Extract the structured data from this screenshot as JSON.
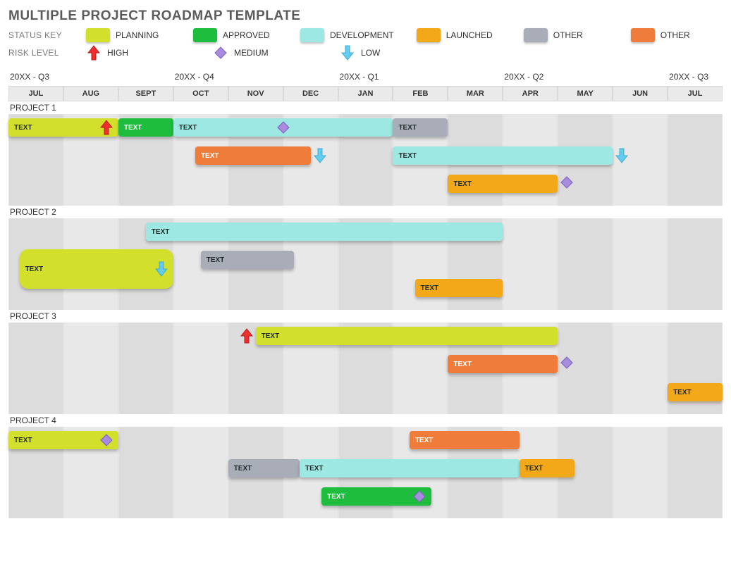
{
  "title": "MULTIPLE PROJECT ROADMAP TEMPLATE",
  "status_key_label": "STATUS KEY",
  "risk_level_label": "RISK LEVEL",
  "status_key": [
    {
      "name": "PLANNING",
      "color": "#d3e02b"
    },
    {
      "name": "APPROVED",
      "color": "#1ebd3d"
    },
    {
      "name": "DEVELOPMENT",
      "color": "#9ee8e3"
    },
    {
      "name": "LAUNCHED",
      "color": "#f2a818"
    },
    {
      "name": "OTHER",
      "color": "#a9adb8"
    },
    {
      "name": "OTHER",
      "color": "#f07c3a"
    }
  ],
  "risk_levels": [
    {
      "name": "HIGH",
      "icon": "arrow-up-red"
    },
    {
      "name": "MEDIUM",
      "icon": "diamond-purple"
    },
    {
      "name": "LOW",
      "icon": "arrow-down-cyan"
    }
  ],
  "quarters": [
    "20XX - Q3",
    "",
    "",
    "20XX - Q4",
    "",
    "",
    "20XX - Q1",
    "",
    "",
    "20XX - Q2",
    "",
    "",
    "20XX - Q3"
  ],
  "months": [
    "JUL",
    "AUG",
    "SEPT",
    "OCT",
    "NOV",
    "DEC",
    "JAN",
    "FEB",
    "MAR",
    "APR",
    "MAY",
    "JUN",
    "JUL"
  ],
  "projects": [
    "PROJECT 1",
    "PROJECT 2",
    "PROJECT 3",
    "PROJECT 4"
  ],
  "chart_data": {
    "type": "gantt",
    "x_units": "months",
    "x_index_zero": "JUL",
    "columns": 13,
    "sections": [
      {
        "name": "PROJECT 1",
        "rows": 3,
        "bars": [
          {
            "label": "TEXT",
            "status": "planning",
            "start": 0,
            "end": 2,
            "row": 0,
            "risk": "high"
          },
          {
            "label": "TEXT",
            "status": "approved",
            "start": 2,
            "end": 3,
            "row": 0
          },
          {
            "label": "TEXT",
            "status": "development",
            "start": 3,
            "end": 7,
            "row": 0,
            "risk": "medium",
            "risk_pos": "mid"
          },
          {
            "label": "TEXT",
            "status": "other1",
            "start": 7,
            "end": 8,
            "row": 0
          },
          {
            "label": "TEXT",
            "status": "other2",
            "start": 3.4,
            "end": 5.5,
            "row": 1,
            "risk": "low",
            "risk_pos": "outside-right"
          },
          {
            "label": "TEXT",
            "status": "development",
            "start": 7,
            "end": 11,
            "row": 1,
            "risk": "low",
            "risk_pos": "outside-right"
          },
          {
            "label": "TEXT",
            "status": "launched",
            "start": 8,
            "end": 10,
            "row": 2,
            "risk": "medium",
            "risk_pos": "outside-right"
          }
        ]
      },
      {
        "name": "PROJECT 2",
        "rows": 3,
        "bars": [
          {
            "label": "TEXT",
            "status": "development",
            "start": 2.5,
            "end": 9,
            "row": 0
          },
          {
            "label": "TEXT",
            "status": "planning",
            "start": 0.2,
            "end": 3,
            "row": 1,
            "big": true,
            "risk": "low"
          },
          {
            "label": "TEXT",
            "status": "other1",
            "start": 3.5,
            "end": 5.2,
            "row": 1
          },
          {
            "label": "TEXT",
            "status": "launched",
            "start": 7.4,
            "end": 9,
            "row": 2
          }
        ]
      },
      {
        "name": "PROJECT 3",
        "rows": 3,
        "bars": [
          {
            "label": "TEXT",
            "status": "planning",
            "start": 4.5,
            "end": 10,
            "row": 0,
            "risk": "high",
            "risk_pos": "outside-left"
          },
          {
            "label": "TEXT",
            "status": "other2",
            "start": 8,
            "end": 10,
            "row": 1,
            "risk": "medium",
            "risk_pos": "outside-right"
          },
          {
            "label": "TEXT",
            "status": "launched",
            "start": 12,
            "end": 13,
            "row": 2
          }
        ]
      },
      {
        "name": "PROJECT 4",
        "rows": 3,
        "bars": [
          {
            "label": "TEXT",
            "status": "planning",
            "start": 0,
            "end": 2,
            "row": 0,
            "risk": "medium"
          },
          {
            "label": "TEXT",
            "status": "other2",
            "start": 7.3,
            "end": 9.3,
            "row": 0
          },
          {
            "label": "TEXT",
            "status": "other1",
            "start": 4,
            "end": 5.3,
            "row": 1
          },
          {
            "label": "TEXT",
            "status": "development",
            "start": 5.3,
            "end": 9.3,
            "row": 1
          },
          {
            "label": "TEXT",
            "status": "launched",
            "start": 9.3,
            "end": 10.3,
            "row": 1
          },
          {
            "label": "TEXT",
            "status": "approved",
            "start": 5.7,
            "end": 7.7,
            "row": 2,
            "risk": "medium"
          }
        ]
      }
    ]
  }
}
